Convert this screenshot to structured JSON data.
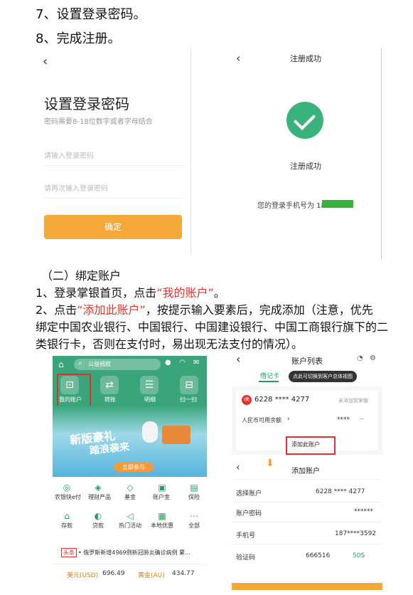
{
  "steps": {
    "step7": "7、设置登录密码。",
    "step8": "8、完成注册。"
  },
  "screen_password": {
    "back": "‹",
    "title": "设置登录密码",
    "subtitle": "密码需要8-18位数字或者字母结合",
    "password_placeholder": "请输入登录密码",
    "confirm_placeholder": "请再次输入登录密码",
    "confirm_button": "确定"
  },
  "screen_success": {
    "back": "‹",
    "header": "注册成功",
    "status": "注册成功",
    "phone_text": "您的登录手机号为 187"
  },
  "section": {
    "heading": "（二）绑定账户",
    "p1_a": "1、登录掌银首页，点击",
    "p1_b": "“我的账户”",
    "p1_c": "。",
    "p2_a": "2、点击",
    "p2_b": "“添加此账户”",
    "p2_c": "，按提示输入要素后，完成添加（注意，优先",
    "p2_line2": "绑定中国农业银行、中国银行、中国建设银行、中国工商银行旗下的二",
    "p2_line3": "类银行卡，否则在支付时，易出现无法支付的情况）。"
  },
  "screen_home": {
    "search_placeholder": "公益捐款",
    "icons": [
      "我的账户",
      "转账",
      "明细",
      "扫一扫"
    ],
    "banner_line1": "新版豪礼",
    "banner_line2": "踏浪袭来",
    "banner_button": "立即参与",
    "grid_row1": [
      "农银快e付",
      "理财产品",
      "基金",
      "账户金",
      "保险"
    ],
    "grid_row2": [
      "存款",
      "贷款",
      "热门活动",
      "本地优惠",
      "全部"
    ],
    "news_tag": "头条",
    "news_text": "• 俄罗斯新增4969例新冠肺炎确诊病例 累...",
    "usd_label": "美元(USD)",
    "usd_value": "696.49",
    "gold_label": "黄金(AU)",
    "gold_value": "434.77"
  },
  "screen_accounts": {
    "back": "‹",
    "title": "账户列表",
    "tab": "借记卡",
    "tooltip": "点此可切换到客户总体视图",
    "card_number": "6228 **** 4277",
    "card_badge": "I类",
    "card_status": "未添加到掌银",
    "balance_label": "人民币可用余额",
    "balance_mask": "****",
    "add_button": "添加此账户",
    "add_title": "添加账户",
    "form": [
      {
        "label": "选择账户",
        "value": "6228 **** 4277"
      },
      {
        "label": "账户密码",
        "value": "******"
      },
      {
        "label": "手机号",
        "value": "187****3592"
      },
      {
        "label": "验证码",
        "value": "666516"
      }
    ],
    "countdown": "50S"
  },
  "colors": {
    "accent_orange": "#f5a83a",
    "success_green": "#39b27b",
    "bank_green": "#2a9a62",
    "highlight_red": "#e0342f"
  }
}
